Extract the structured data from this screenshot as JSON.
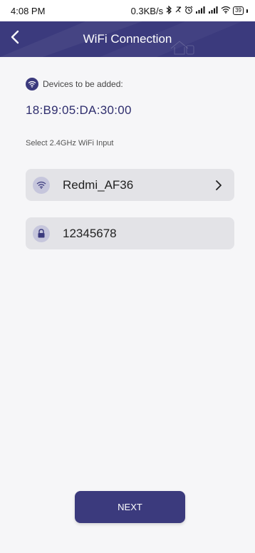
{
  "status_bar": {
    "time": "4:08 PM",
    "network_speed": "0.3KB/s",
    "battery": "39",
    "icons": [
      "bluetooth-icon",
      "do-not-disturb-icon",
      "alarm-icon",
      "signal-icon",
      "signal-icon",
      "wifi-icon",
      "battery-icon"
    ]
  },
  "header": {
    "title": "WiFi Connection",
    "back_icon": "chevron-left-icon"
  },
  "device": {
    "label": "Devices to be added:",
    "mac": "18:B9:05:DA:30:00"
  },
  "wifi_select": {
    "label": "Select 2.4GHz WiFi Input",
    "ssid": "Redmi_AF36",
    "password": "12345678"
  },
  "actions": {
    "next_label": "NEXT"
  },
  "colors": {
    "primary": "#3b3a7d",
    "field_bg": "#e3e3e7",
    "icon_circle": "#c6c6dc",
    "page_bg": "#f6f6f8"
  }
}
